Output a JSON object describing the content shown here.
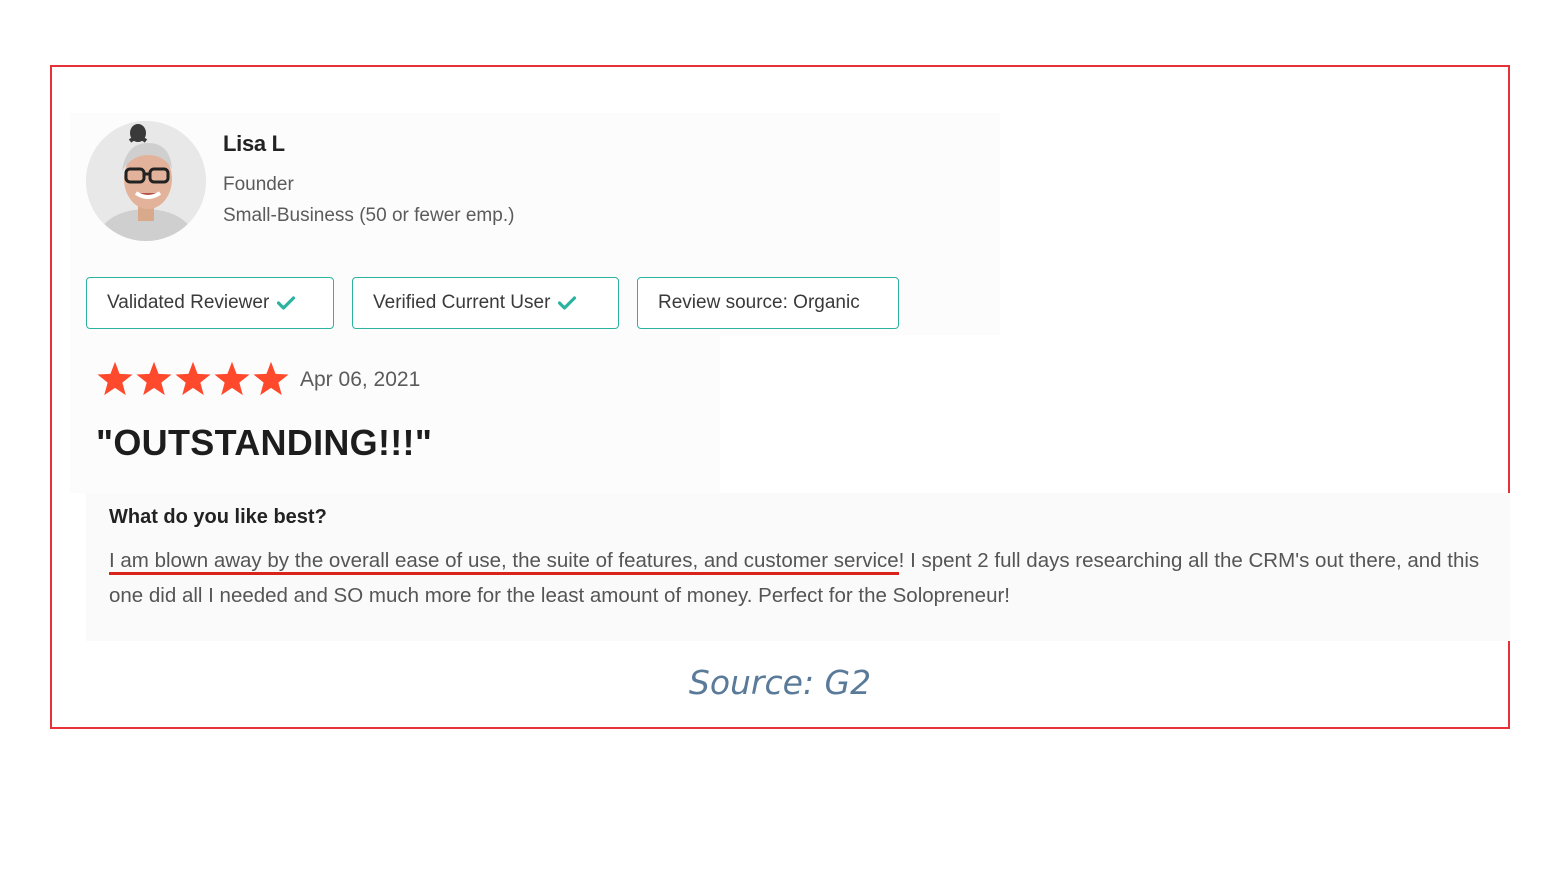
{
  "reviewer": {
    "name": "Lisa L",
    "role": "Founder",
    "company_size": "Small-Business (50 or fewer emp.)"
  },
  "badges": [
    {
      "label": "Validated Reviewer",
      "check": true
    },
    {
      "label": "Verified Current User",
      "check": true
    },
    {
      "label": "Review source: Organic",
      "check": false
    }
  ],
  "rating": {
    "stars": 5,
    "max_stars": 5,
    "date": "Apr 06, 2021"
  },
  "review": {
    "title": "\"OUTSTANDING!!!\"",
    "question": "What do you like best?",
    "answer_highlight": "I am blown away by the overall ease of use, the suite of features, and customer service",
    "answer_rest": "! I spent 2 full days researching all the CRM's out there, and this one did all I needed and SO much more for the least amount of money. Perfect for the Solopreneur!"
  },
  "caption": "Source: G2",
  "colors": {
    "frame_border": "#e53238",
    "badge_border": "#2bb3a0",
    "check": "#2bb3a0",
    "star": "#ff492c",
    "highlight_underline": "#d9241b",
    "caption": "#5a7a9a"
  },
  "icons": [
    "check-icon",
    "star-icon",
    "avatar-photo"
  ]
}
